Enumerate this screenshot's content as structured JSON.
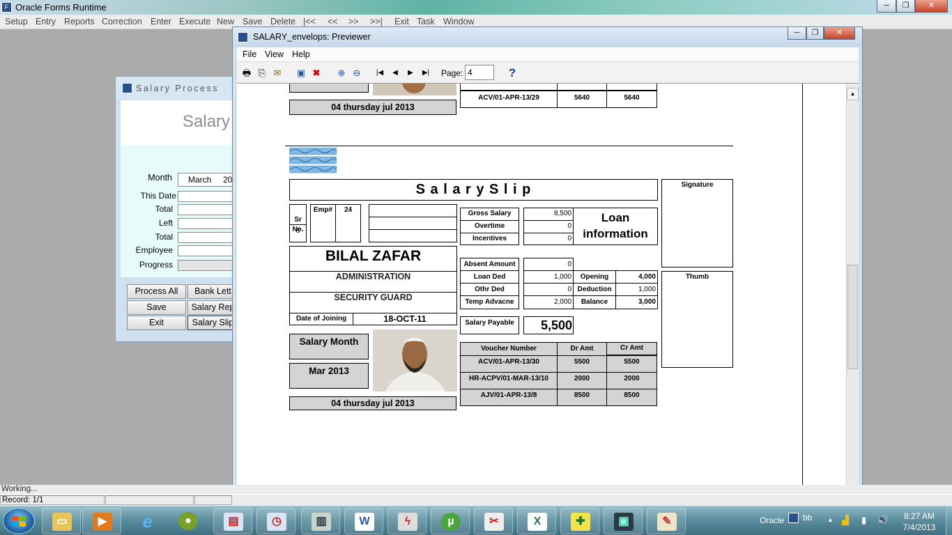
{
  "app": {
    "title": "Oracle Forms Runtime",
    "menu": [
      "Setup",
      "Entry",
      "Reports",
      "Correction",
      "Enter",
      "Execute",
      "New",
      "Save",
      "Delete",
      "|<<",
      "<<",
      ">>",
      ">>|",
      "Exit",
      "Task",
      "Window"
    ]
  },
  "window_controls": {
    "minimize": "─",
    "restore": "❐",
    "close": "✕"
  },
  "salary_process": {
    "title": "Salary Process",
    "banner": "Salary",
    "fields": {
      "month_label": "Month",
      "month_value": "March",
      "year_value": "20",
      "this_date_label": "This Date",
      "total_label": "Total",
      "left_label": "Left",
      "total2_label": "Total",
      "employee_label": "Employee",
      "progress_label": "Progress"
    },
    "buttons": {
      "process_all": "Process All",
      "bank_letter": "Bank Lett",
      "save": "Save",
      "salary_report": "Salary Rep",
      "exit": "Exit",
      "salary_slip": "Salary Slip"
    }
  },
  "previewer": {
    "title": "SALARY_envelops: Previewer",
    "menu": [
      "File",
      "View",
      "Help"
    ],
    "page_label": "Page:",
    "page_value": "4",
    "help_icon": "?"
  },
  "slip_prev": {
    "date_line": "04 thursday  jul 2013",
    "voucher": "ACV/01-APR-13/29",
    "dr": "5640",
    "cr": "5640"
  },
  "slip": {
    "title": "S a l a r y S l i p",
    "signature_label": "Signature",
    "thumb_label": "Thumb",
    "sr_label": "Sr\nNo.",
    "sr_value": "8",
    "emp_label": "Emp#",
    "emp_value": "24",
    "employee_name": "BILAL ZAFAR",
    "department": "ADMINISTRATION",
    "designation": "SECURITY GUARD",
    "doj_label": "Date of Joining",
    "doj_value": "18-OCT-11",
    "salary_month_label": "Salary Month",
    "salary_month_value": "Mar 2013",
    "date_line": "04 thursday  jul 2013",
    "earnings": [
      {
        "label": "Gross Salary",
        "value": "8,500"
      },
      {
        "label": "Overtime",
        "value": "0"
      },
      {
        "label": "Incentives",
        "value": "0"
      }
    ],
    "loan_info_label": "Loan\ninformation",
    "deductions": [
      {
        "label": "Absent Amount",
        "value": "0"
      },
      {
        "label": "Loan Ded",
        "value": "1,000"
      },
      {
        "label": "Othr Ded",
        "value": "0"
      },
      {
        "label": "Temp Advacne",
        "value": "2,000"
      }
    ],
    "loan": [
      {
        "label": "Opening",
        "value": "4,000"
      },
      {
        "label": "Deduction",
        "value": "1,000"
      },
      {
        "label": "Balance",
        "value": "3,000"
      }
    ],
    "payable_label": "Salary Payable",
    "payable_value": "5,500",
    "voucher_headers": [
      "Voucher Number",
      "Dr Amt",
      "Cr Amt"
    ],
    "vouchers": [
      {
        "number": "ACV/01-APR-13/30",
        "dr": "5500",
        "cr": "5500"
      },
      {
        "number": "HR-ACPV/01-MAR-13/10",
        "dr": "2000",
        "cr": "2000"
      },
      {
        "number": "AJV/01-APR-13/8",
        "dr": "8500",
        "cr": "8500"
      }
    ]
  },
  "status": {
    "line1": "Working...",
    "record": "Record: 1/1"
  },
  "taskbar": {
    "tray_text": "Oracle",
    "tray_user": "bb",
    "time": "8:27 AM",
    "date": "7/4/2013",
    "apps": [
      "explorer",
      "media-player",
      "internet-explorer",
      "frog-app",
      "forms-app",
      "reports-app",
      "network-app",
      "word",
      "flash-app",
      "utorrent",
      "snip-app",
      "excel",
      "health-app",
      "monitor-app",
      "paint"
    ]
  }
}
